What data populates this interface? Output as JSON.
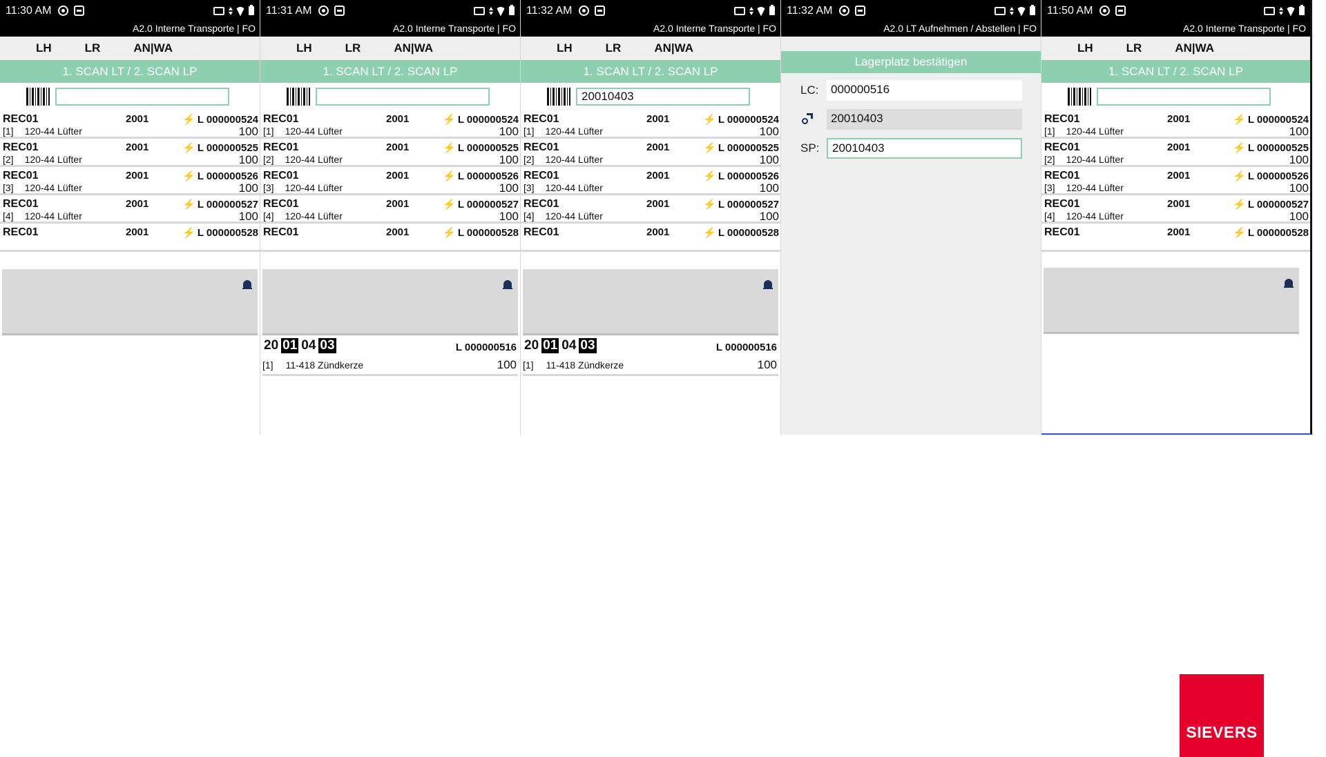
{
  "screens": [
    {
      "time": "11:30 AM",
      "app_title": "A2.0 Interne Transporte | FO",
      "tabs": [
        "LH",
        "LR",
        "AN|WA"
      ],
      "scan_hint": "1. SCAN LT / 2. SCAN LP",
      "scan_value": "",
      "rows": [
        {
          "code": "REC01",
          "num": "2001",
          "lc": "L 000000524",
          "pos": "[1]",
          "desc": "120-44 Lüfter",
          "qty": "100"
        },
        {
          "code": "REC01",
          "num": "2001",
          "lc": "L 000000525",
          "pos": "[2]",
          "desc": "120-44 Lüfter",
          "qty": "100"
        },
        {
          "code": "REC01",
          "num": "2001",
          "lc": "L 000000526",
          "pos": "[3]",
          "desc": "120-44 Lüfter",
          "qty": "100"
        },
        {
          "code": "REC01",
          "num": "2001",
          "lc": "L 000000527",
          "pos": "[4]",
          "desc": "120-44 Lüfter",
          "qty": "100"
        },
        {
          "code": "REC01",
          "num": "2001",
          "lc": "L 000000528",
          "pos": "",
          "desc": "",
          "qty": ""
        }
      ]
    },
    {
      "time": "11:31 AM",
      "app_title": "A2.0 Interne Transporte | FO",
      "tabs": [
        "LH",
        "LR",
        "AN|WA"
      ],
      "scan_hint": "1. SCAN LT / 2. SCAN LP",
      "scan_value": "",
      "rows": [
        {
          "code": "REC01",
          "num": "2001",
          "lc": "L 000000524",
          "pos": "[1]",
          "desc": "120-44 Lüfter",
          "qty": "100"
        },
        {
          "code": "REC01",
          "num": "2001",
          "lc": "L 000000525",
          "pos": "[2]",
          "desc": "120-44 Lüfter",
          "qty": "100"
        },
        {
          "code": "REC01",
          "num": "2001",
          "lc": "L 000000526",
          "pos": "[3]",
          "desc": "120-44 Lüfter",
          "qty": "100"
        },
        {
          "code": "REC01",
          "num": "2001",
          "lc": "L 000000527",
          "pos": "[4]",
          "desc": "120-44 Lüfter",
          "qty": "100"
        },
        {
          "code": "REC01",
          "num": "2001",
          "lc": "L 000000528",
          "pos": "",
          "desc": "",
          "qty": ""
        }
      ],
      "selected": {
        "code_parts": [
          "20",
          "01",
          "04",
          "03"
        ],
        "lc": "L 000000516",
        "pos": "[1]",
        "desc": "11-418 Zündkerze",
        "qty": "100"
      }
    },
    {
      "time": "11:32 AM",
      "app_title": "A2.0 Interne Transporte | FO",
      "tabs": [
        "LH",
        "LR",
        "AN|WA"
      ],
      "scan_hint": "1. SCAN LT / 2. SCAN LP",
      "scan_value": "20010403",
      "rows": [
        {
          "code": "REC01",
          "num": "2001",
          "lc": "L 000000524",
          "pos": "[1]",
          "desc": "120-44 Lüfter",
          "qty": "100"
        },
        {
          "code": "REC01",
          "num": "2001",
          "lc": "L 000000525",
          "pos": "[2]",
          "desc": "120-44 Lüfter",
          "qty": "100"
        },
        {
          "code": "REC01",
          "num": "2001",
          "lc": "L 000000526",
          "pos": "[3]",
          "desc": "120-44 Lüfter",
          "qty": "100"
        },
        {
          "code": "REC01",
          "num": "2001",
          "lc": "L 000000527",
          "pos": "[4]",
          "desc": "120-44 Lüfter",
          "qty": "100"
        },
        {
          "code": "REC01",
          "num": "2001",
          "lc": "L 000000528",
          "pos": "",
          "desc": "",
          "qty": ""
        }
      ],
      "selected": {
        "code_parts": [
          "20",
          "01",
          "04",
          "03"
        ],
        "lc": "L 000000516",
        "pos": "[1]",
        "desc": "11-418 Zündkerze",
        "qty": "100"
      }
    },
    {
      "time": "11:32 AM",
      "app_title": "A2.0 LT Aufnehmen / Abstellen | FO",
      "confirm_title": "Lagerplatz bestätigen",
      "lc_label": "LC:",
      "lc_value": "000000516",
      "pallet_value": "20010403",
      "sp_label": "SP:",
      "sp_value": "20010403"
    },
    {
      "time": "11:50 AM",
      "app_title": "A2.0 Interne Transporte | FO",
      "tabs": [
        "LH",
        "LR",
        "AN|WA"
      ],
      "scan_hint": "1. SCAN LT / 2. SCAN LP",
      "scan_value": "",
      "rows": [
        {
          "code": "REC01",
          "num": "2001",
          "lc": "L 000000524",
          "pos": "[1]",
          "desc": "120-44 Lüfter",
          "qty": "100"
        },
        {
          "code": "REC01",
          "num": "2001",
          "lc": "L 000000525",
          "pos": "[2]",
          "desc": "120-44 Lüfter",
          "qty": "100"
        },
        {
          "code": "REC01",
          "num": "2001",
          "lc": "L 000000526",
          "pos": "[3]",
          "desc": "120-44 Lüfter",
          "qty": "100"
        },
        {
          "code": "REC01",
          "num": "2001",
          "lc": "L 000000527",
          "pos": "[4]",
          "desc": "120-44 Lüfter",
          "qty": "100"
        },
        {
          "code": "REC01",
          "num": "2001",
          "lc": "L 000000528",
          "pos": "",
          "desc": "",
          "qty": ""
        }
      ]
    }
  ],
  "brand": {
    "name": "SIEVERS",
    "color": "#e4002b"
  },
  "colors": {
    "accent": "#8dcfae",
    "bolt": "#f5b000"
  }
}
